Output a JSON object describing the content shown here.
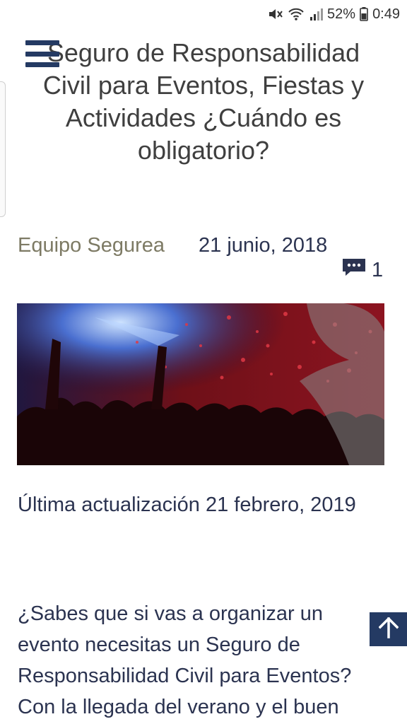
{
  "status_bar": {
    "battery_percent": "52%",
    "time": "0:49",
    "icons": [
      "mute-icon",
      "wifi-icon",
      "signal-icon",
      "battery-icon"
    ]
  },
  "header": {
    "menu_icon": "hamburger-menu-icon"
  },
  "post": {
    "title": "Seguro de Responsabilidad Civil para Eventos, Fiestas y Actividades ¿Cuándo es obligatorio?",
    "author": "Equipo Segurea",
    "date": "21 junio, 2018",
    "comment_count": "1",
    "updated": "Última actualización 21 febrero, 2019",
    "body": "¿Sabes que si vas a organizar un evento necesitas un Seguro de Responsabilidad Civil para Eventos? Con la llegada del verano y el buen"
  },
  "colors": {
    "navy": "#243a63",
    "text": "#2b3350",
    "author": "#7d7a64",
    "title": "#3f3f3f"
  }
}
